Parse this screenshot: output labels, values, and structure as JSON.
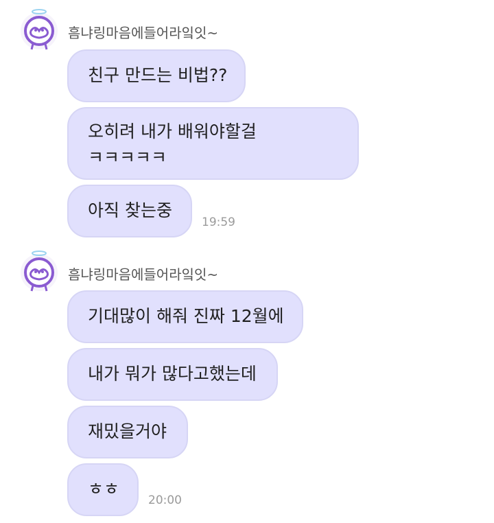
{
  "groups": [
    {
      "sender": "흠냐링마음에들어라잌잇~",
      "time": "19:59",
      "messages": [
        {
          "lines": [
            "친구 만드는 비법??"
          ]
        },
        {
          "lines": [
            "오히려 내가 배워야할걸",
            "ㅋㅋㅋㅋㅋ"
          ]
        },
        {
          "lines": [
            "아직 찾는중"
          ]
        }
      ]
    },
    {
      "sender": "흠냐링마음에들어라잌잇~",
      "time": "20:00",
      "messages": [
        {
          "lines": [
            "기대많이 해줘 진짜 12월에"
          ]
        },
        {
          "lines": [
            "내가 뭐가 많다고했는데"
          ]
        },
        {
          "lines": [
            "재밌을거야"
          ]
        },
        {
          "lines": [
            "ㅎㅎ"
          ]
        }
      ]
    }
  ],
  "colors": {
    "bubble": "#e1e0fd",
    "bubble_border": "#d6d5f5",
    "avatar_accent": "#8a5bd1"
  },
  "icons": {
    "avatar": "purple-bear-with-halo-icon"
  }
}
